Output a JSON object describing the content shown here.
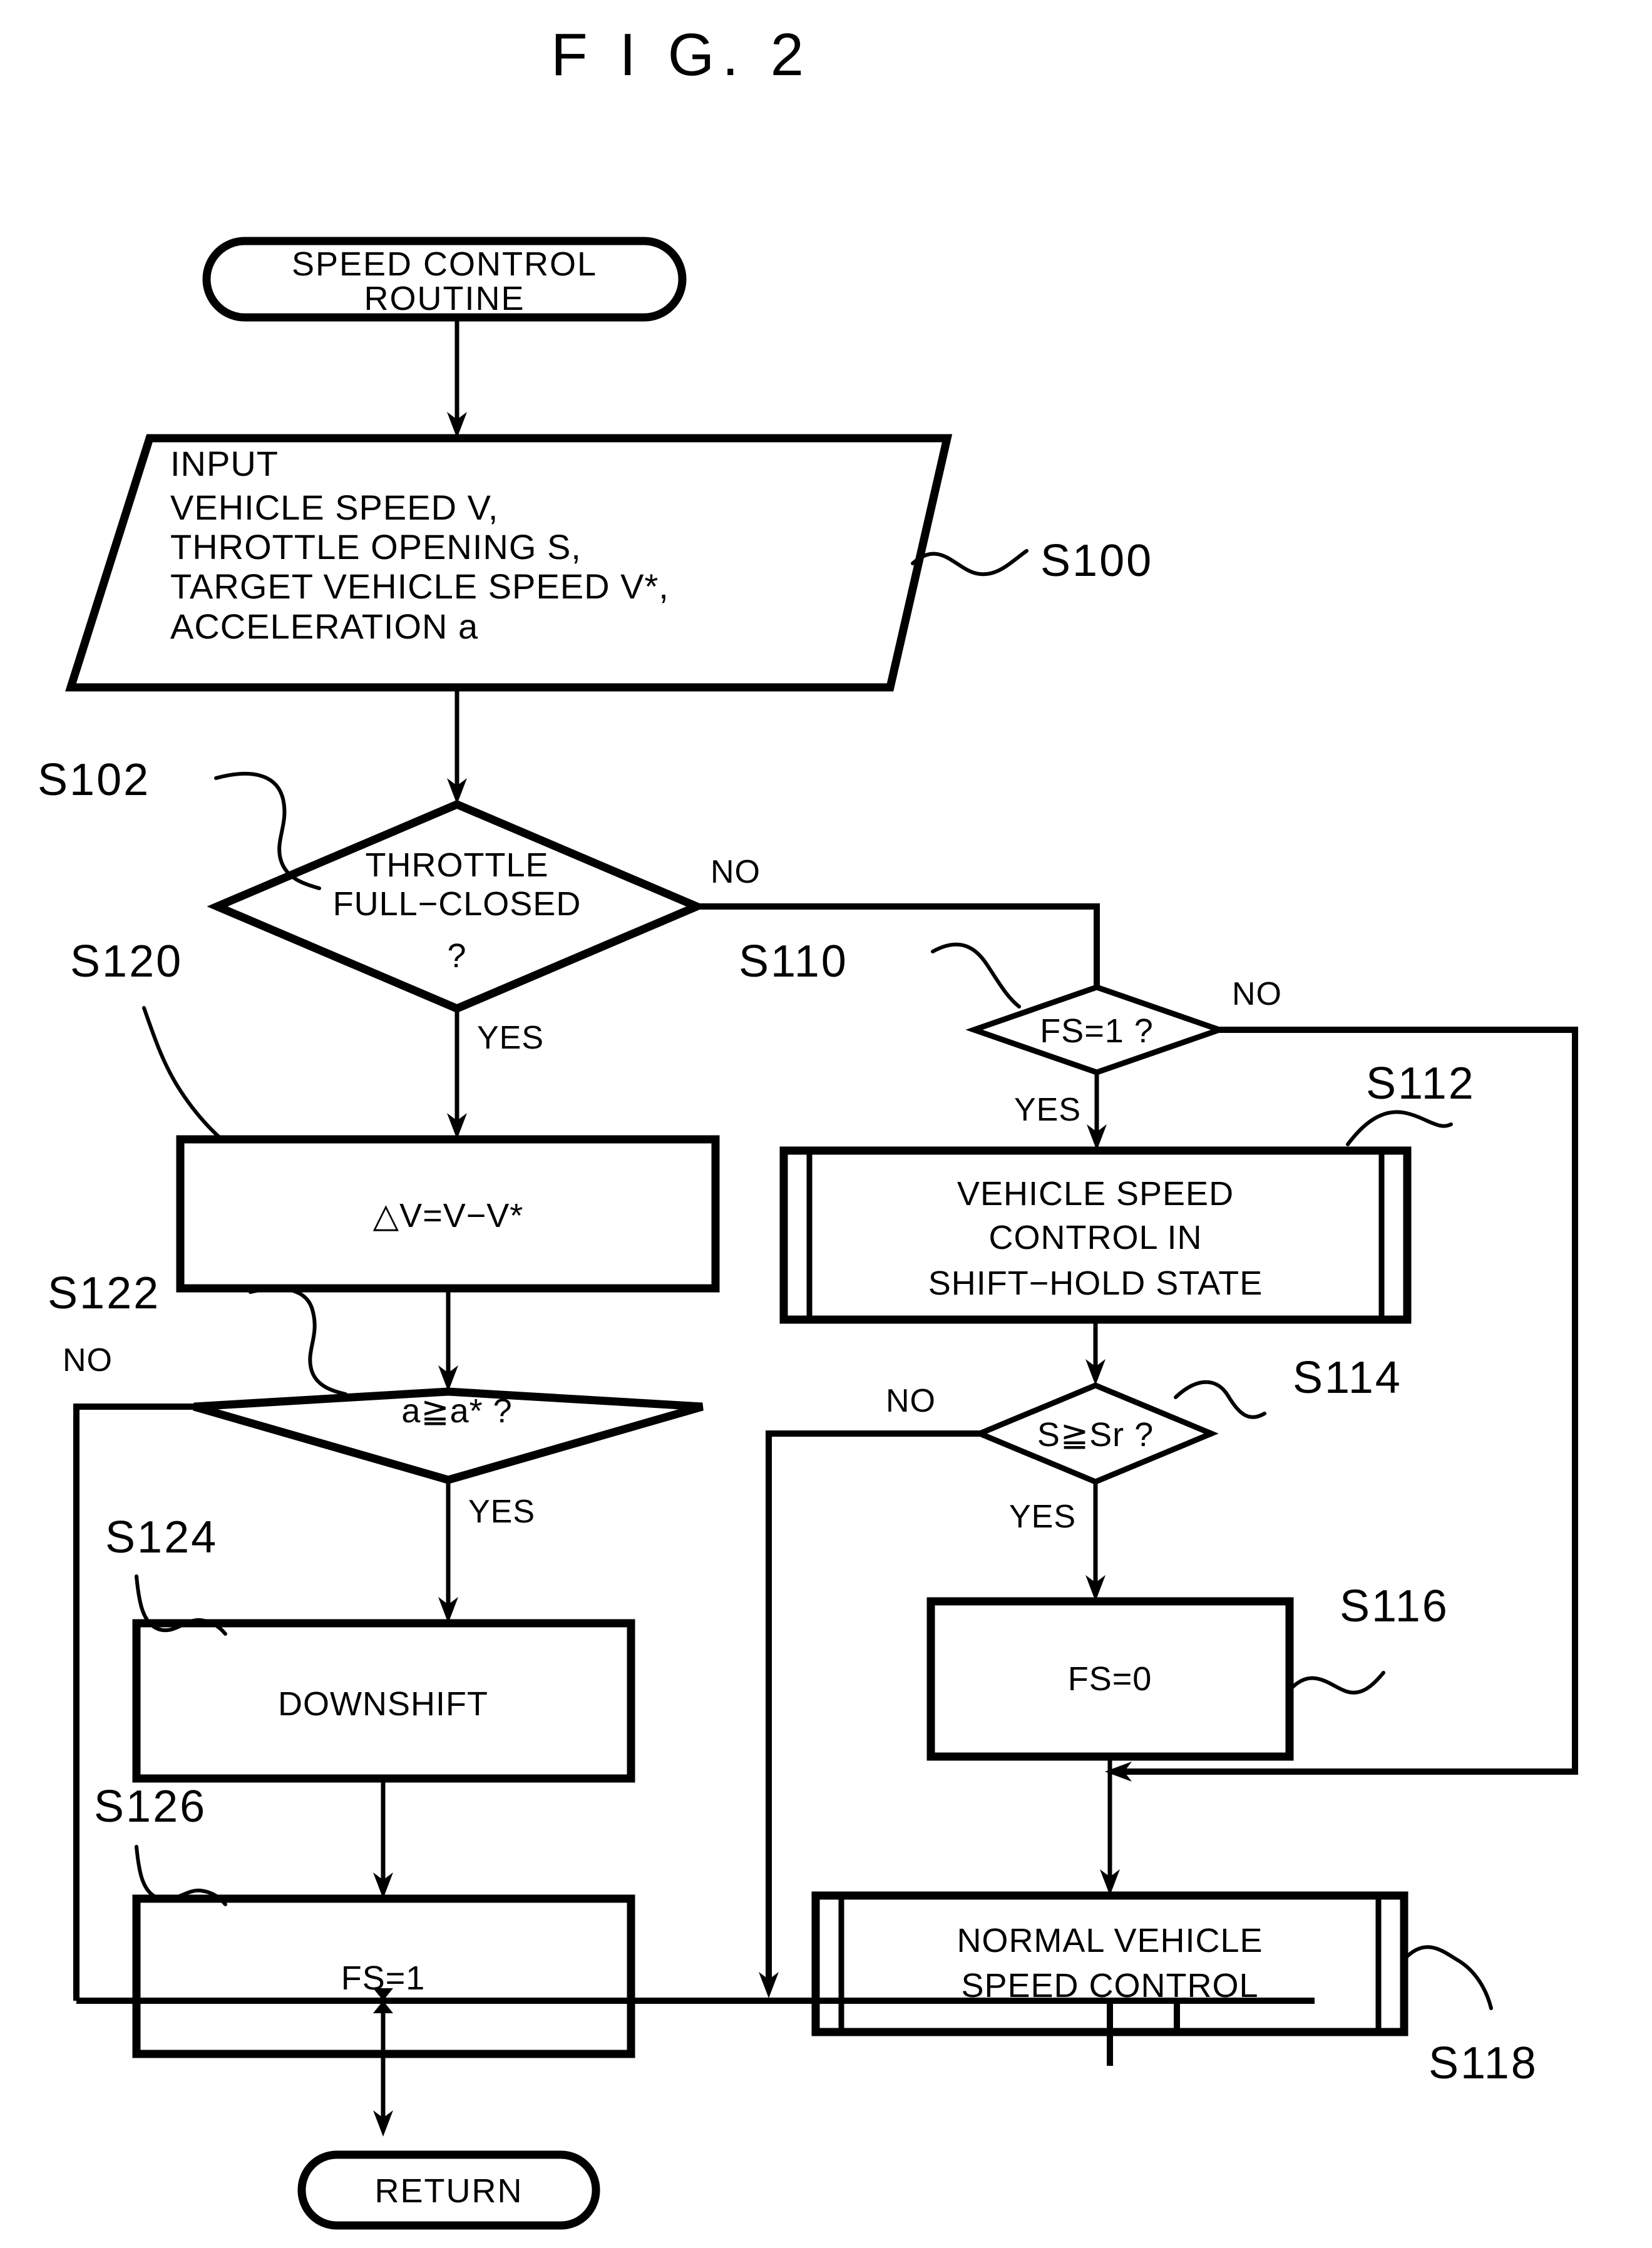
{
  "figure": {
    "title": "F I G. 2"
  },
  "nodes": {
    "start": {
      "line1": "SPEED  CONTROL",
      "line2": "ROUTINE"
    },
    "input": {
      "line1": "INPUT",
      "line2": "VEHICLE  SPEED  V,",
      "line3": "THROTTLE  OPENING  S,",
      "line4": "TARGET  VEHICLE  SPEED  V*,",
      "line5": "ACCELERATION  a"
    },
    "s102": {
      "line1": "THROTTLE",
      "line2": "FULL−CLOSED",
      "line3": "?"
    },
    "s110": {
      "line1": "FS=1 ?"
    },
    "s112": {
      "line1": "VEHICLE  SPEED",
      "line2": "CONTROL  IN",
      "line3": "SHIFT−HOLD  STATE"
    },
    "s114": {
      "line1": "S≧Sr ?"
    },
    "s116": {
      "line1": "FS=0"
    },
    "s118": {
      "line1": "NORMAL  VEHICLE",
      "line2": "SPEED  CONTROL"
    },
    "s120": {
      "line1": "△V=V−V*"
    },
    "s122": {
      "line1": "a≧a* ?"
    },
    "s124": {
      "line1": "DOWNSHIFT"
    },
    "s126": {
      "line1": "FS=1"
    },
    "end": {
      "line1": "RETURN"
    }
  },
  "step_labels": {
    "s100": "S100",
    "s102": "S102",
    "s110": "S110",
    "s112": "S112",
    "s114": "S114",
    "s116": "S116",
    "s118": "S118",
    "s120": "S120",
    "s122": "S122",
    "s124": "S124",
    "s126": "S126"
  },
  "branch_labels": {
    "s102_no": "NO",
    "s102_yes": "YES",
    "s110_no": "NO",
    "s110_yes": "YES",
    "s114_no": "NO",
    "s114_yes": "YES",
    "s122_no": "NO",
    "s122_yes": "YES"
  },
  "colors": {
    "ink": "#000000",
    "paper": "#ffffff"
  }
}
